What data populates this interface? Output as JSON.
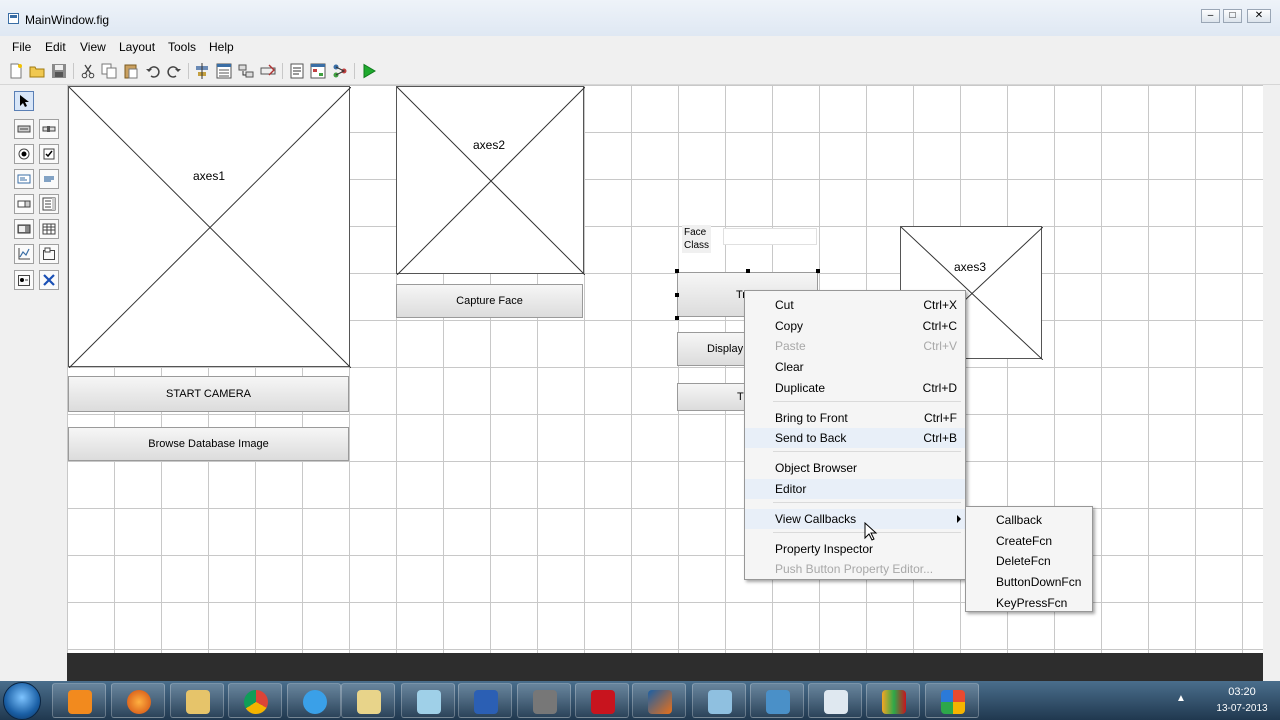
{
  "window": {
    "title": "MainWindow.fig",
    "min": "–",
    "max": "□",
    "close": "✕"
  },
  "menu": [
    "File",
    "Edit",
    "View",
    "Layout",
    "Tools",
    "Help"
  ],
  "toolbar_icons": [
    "new-icon",
    "open-icon",
    "save-icon",
    "cut-icon",
    "copy-icon",
    "paste-icon",
    "undo-icon",
    "redo-icon",
    "align-icon",
    "menu-editor-icon",
    "tab-order-icon",
    "toolbar-editor-icon",
    "mfile-editor-icon",
    "property-inspector-icon",
    "object-browser-icon",
    "run-icon"
  ],
  "palette_icons": [
    "select-arrow-icon",
    "pushbutton-icon",
    "slider-icon",
    "radio-button-icon",
    "checkbox-icon",
    "edit-text-icon",
    "static-text-icon",
    "popup-menu-icon",
    "listbox-icon",
    "toggle-button-icon",
    "table-icon",
    "axes-icon",
    "panel-icon",
    "button-group-icon",
    "activex-icon"
  ],
  "canvas": {
    "axes1": "axes1",
    "axes2": "axes2",
    "axes3": "axes3",
    "start_camera": "START CAMERA",
    "browse_db": "Browse Database Image",
    "capture_face": "Capture Face",
    "face_class_line1": "Face",
    "face_class_line2": "Class",
    "btn_train_partial": "Tr",
    "btn_display_partial": "Display",
    "btn_t_partial": "T"
  },
  "context_menu": {
    "items": [
      {
        "label": "Cut",
        "shortcut": "Ctrl+X"
      },
      {
        "label": "Copy",
        "shortcut": "Ctrl+C"
      },
      {
        "label": "Paste",
        "shortcut": "Ctrl+V",
        "disabled": true
      },
      {
        "label": "Clear",
        "shortcut": ""
      },
      {
        "label": "Duplicate",
        "shortcut": "Ctrl+D"
      },
      {
        "label": "Bring to Front",
        "shortcut": "Ctrl+F"
      },
      {
        "label": "Send to Back",
        "shortcut": "Ctrl+B"
      },
      {
        "label": "Object Browser",
        "shortcut": ""
      },
      {
        "label": "Editor",
        "shortcut": ""
      },
      {
        "label": "View Callbacks",
        "shortcut": ""
      },
      {
        "label": "Property Inspector",
        "shortcut": ""
      },
      {
        "label": "Push Button Property Editor...",
        "shortcut": "",
        "disabled": true
      }
    ]
  },
  "submenu": {
    "items": [
      "Callback",
      "CreateFcn",
      "DeleteFcn",
      "ButtonDownFcn",
      "KeyPressFcn"
    ]
  },
  "taskbar": {
    "apps": [
      "media-player-icon",
      "firefox-icon",
      "explorer-folder-icon",
      "chrome-icon",
      "internet-explorer-icon",
      "file-manager-icon",
      "notepad-icon",
      "word-icon",
      "scanner-icon",
      "acrobat-icon",
      "matlab-icon",
      "paint-icon",
      "photo-viewer-icon",
      "document-viewer-icon",
      "live-messenger-icon",
      "tiles-icon"
    ],
    "time": "03:20",
    "date": "13-07-2013"
  },
  "colors": {
    "grid": "#c8c8c8",
    "taskbar": "#2a4a66",
    "run": "#1faa2e"
  }
}
